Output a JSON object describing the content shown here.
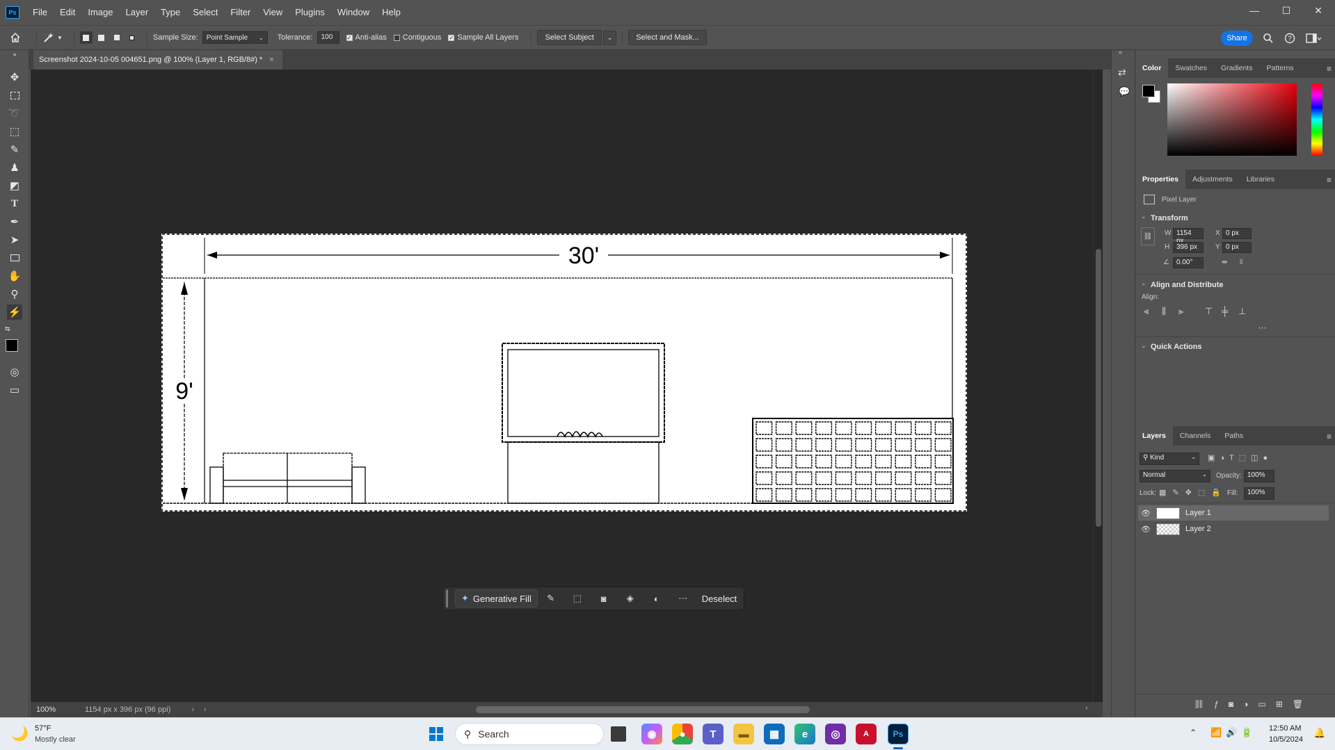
{
  "app": {
    "logo": "Ps"
  },
  "menu": [
    "File",
    "Edit",
    "Image",
    "Layer",
    "Type",
    "Select",
    "Filter",
    "View",
    "Plugins",
    "Window",
    "Help"
  ],
  "window_controls": {
    "minimize": "—",
    "maximize": "☐",
    "close": "✕"
  },
  "options": {
    "sample_size_label": "Sample Size:",
    "sample_size_value": "Point Sample",
    "tolerance_label": "Tolerance:",
    "tolerance_value": "100",
    "anti_alias": "Anti-alias",
    "contiguous": "Contiguous",
    "sample_all_layers": "Sample All Layers",
    "select_subject": "Select Subject",
    "select_and_mask": "Select and Mask...",
    "share": "Share"
  },
  "document": {
    "tab_title": "Screenshot 2024-10-05 004651.png @ 100% (Layer 1, RGB/8#) *",
    "close": "×",
    "zoom": "100%",
    "doc_info": "1154 px x 396 px (96 ppi)",
    "width_dim_label": "30'",
    "height_dim_label": "9'"
  },
  "contextual_bar": {
    "generative_fill": "Generative Fill",
    "deselect": "Deselect"
  },
  "color_panel": {
    "tabs": [
      "Color",
      "Swatches",
      "Gradients",
      "Patterns"
    ],
    "hue_accent": "#e8000b"
  },
  "properties_panel": {
    "tabs": [
      "Properties",
      "Adjustments",
      "Libraries"
    ],
    "layer_type": "Pixel Layer",
    "transform_title": "Transform",
    "w_label": "W",
    "w_value": "1154 px",
    "h_label": "H",
    "h_value": "396 px",
    "x_label": "X",
    "x_value": "0 px",
    "y_label": "Y",
    "y_value": "0 px",
    "angle_value": "0.00°",
    "align_title": "Align and Distribute",
    "align_label": "Align:",
    "quick_actions_title": "Quick Actions"
  },
  "layers_panel": {
    "tabs": [
      "Layers",
      "Channels",
      "Paths"
    ],
    "kind": "Kind",
    "blend_mode": "Normal",
    "opacity_label": "Opacity:",
    "opacity_value": "100%",
    "lock_label": "Lock:",
    "fill_label": "Fill:",
    "fill_value": "100%",
    "layers": [
      {
        "name": "Layer 1",
        "selected": true
      },
      {
        "name": "Layer 2",
        "selected": false
      }
    ]
  },
  "taskbar": {
    "weather_temp": "57°F",
    "weather_desc": "Mostly clear",
    "search_placeholder": "Search",
    "time": "12:50 AM",
    "date": "10/5/2024"
  }
}
